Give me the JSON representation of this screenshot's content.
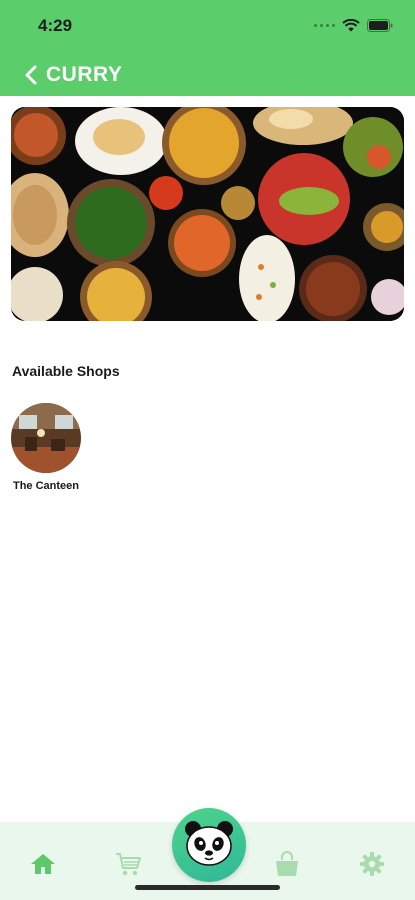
{
  "status_bar": {
    "time": "4:29"
  },
  "header": {
    "title": "CURRY"
  },
  "banner": {
    "alt": ""
  },
  "shops_section": {
    "title": "Available Shops",
    "shops": [
      {
        "name": "The Canteen"
      }
    ]
  },
  "bottom_nav": {
    "items": [
      {
        "icon": "home-icon",
        "active": true
      },
      {
        "icon": "cart-icon",
        "active": false
      },
      {
        "icon": "panda-icon",
        "active": false
      },
      {
        "icon": "shopping-bag-icon",
        "active": false
      },
      {
        "icon": "gear-icon",
        "active": false
      }
    ]
  },
  "colors": {
    "header": "#5ccd6b",
    "nav_background": "#eaf7ec",
    "nav_icon": "#5cc96b"
  }
}
